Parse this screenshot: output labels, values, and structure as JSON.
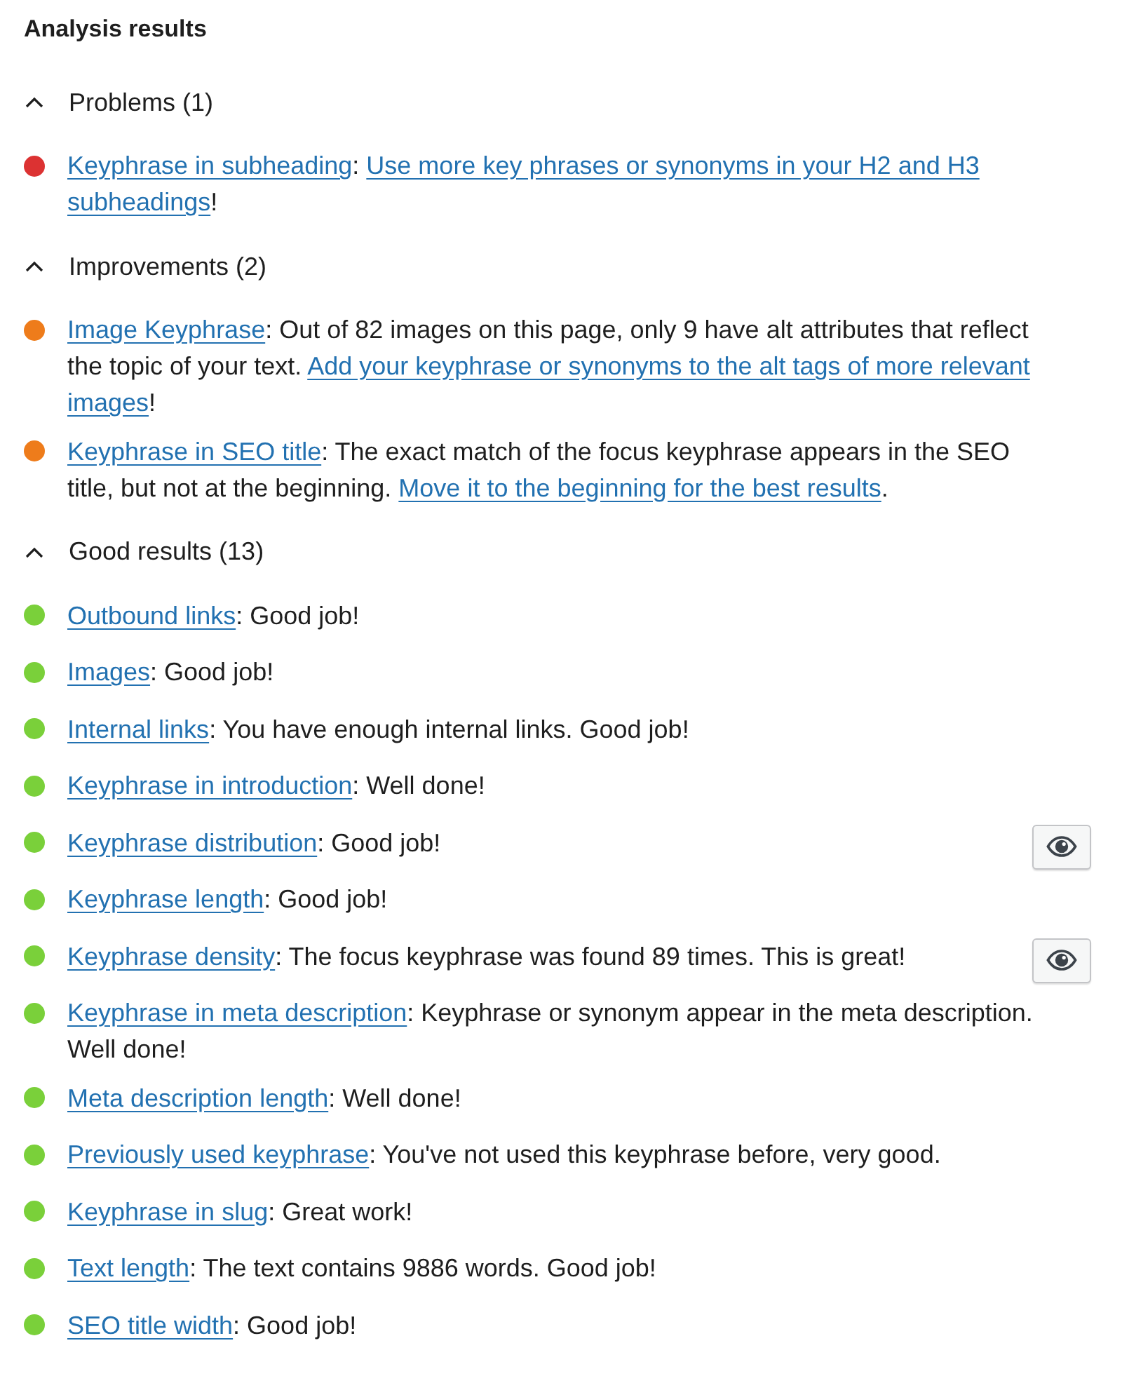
{
  "title": "Analysis results",
  "sections": [
    {
      "heading": "Problems (1)",
      "expanded": true,
      "results": [
        {
          "color": "#dc3232",
          "highlight_button": false,
          "segments": [
            {
              "text": "Keyphrase in subheading",
              "kind": "link"
            },
            {
              "text": ": ",
              "kind": "plain"
            },
            {
              "text": "Use more key phrases or synonyms in your H2 and H3",
              "kind": "link"
            },
            {
              "text": "subheadings",
              "kind": "link"
            },
            {
              "text": "!",
              "kind": "plain"
            }
          ]
        }
      ]
    },
    {
      "heading": "Improvements (2)",
      "expanded": true,
      "results": [
        {
          "color": "#ee7c1b",
          "highlight_button": false,
          "segments": [
            {
              "text": "Image Keyphrase",
              "kind": "link"
            },
            {
              "text": ": Out of 82 images on this page, only 9 have alt attributes that reflect the topic of your text. ",
              "kind": "plain"
            },
            {
              "text": "Add your keyphrase or synonyms to the alt tags of more relevant",
              "kind": "link"
            },
            {
              "text": "images",
              "kind": "link"
            },
            {
              "text": "!",
              "kind": "plain"
            }
          ]
        },
        {
          "color": "#ee7c1b",
          "highlight_button": false,
          "segments": [
            {
              "text": "Keyphrase in SEO title",
              "kind": "link"
            },
            {
              "text": ": The exact match of the focus keyphrase appears in the SEO title, but not at the beginning. ",
              "kind": "plain"
            },
            {
              "text": "Move it to the beginning for the best results",
              "kind": "link"
            },
            {
              "text": ".",
              "kind": "plain"
            }
          ]
        }
      ]
    },
    {
      "heading": "Good results (13)",
      "expanded": true,
      "results": [
        {
          "color": "#7ad03a",
          "highlight_button": false,
          "segments": [
            {
              "text": "Outbound links",
              "kind": "link"
            },
            {
              "text": ": Good job!",
              "kind": "plain"
            }
          ]
        },
        {
          "color": "#7ad03a",
          "highlight_button": false,
          "segments": [
            {
              "text": "Images",
              "kind": "link"
            },
            {
              "text": ": Good job!",
              "kind": "plain"
            }
          ]
        },
        {
          "color": "#7ad03a",
          "highlight_button": false,
          "segments": [
            {
              "text": "Internal links",
              "kind": "link"
            },
            {
              "text": ": You have enough internal links. Good job!",
              "kind": "plain"
            }
          ]
        },
        {
          "color": "#7ad03a",
          "highlight_button": false,
          "segments": [
            {
              "text": "Keyphrase in introduction",
              "kind": "link"
            },
            {
              "text": ": Well done!",
              "kind": "plain"
            }
          ]
        },
        {
          "color": "#7ad03a",
          "highlight_button": true,
          "segments": [
            {
              "text": "Keyphrase distribution",
              "kind": "link"
            },
            {
              "text": ": Good job!",
              "kind": "plain"
            }
          ]
        },
        {
          "color": "#7ad03a",
          "highlight_button": false,
          "segments": [
            {
              "text": "Keyphrase length",
              "kind": "link"
            },
            {
              "text": ": Good job!",
              "kind": "plain"
            }
          ]
        },
        {
          "color": "#7ad03a",
          "highlight_button": true,
          "segments": [
            {
              "text": "Keyphrase density",
              "kind": "link"
            },
            {
              "text": ": The focus keyphrase was found 89 times. This is great!",
              "kind": "plain"
            }
          ]
        },
        {
          "color": "#7ad03a",
          "highlight_button": false,
          "segments": [
            {
              "text": "Keyphrase in meta description",
              "kind": "link"
            },
            {
              "text": ": Keyphrase or synonym appear in the meta description. Well done!",
              "kind": "plain"
            }
          ]
        },
        {
          "color": "#7ad03a",
          "highlight_button": false,
          "segments": [
            {
              "text": "Meta description length",
              "kind": "link"
            },
            {
              "text": ": Well done!",
              "kind": "plain"
            }
          ]
        },
        {
          "color": "#7ad03a",
          "highlight_button": false,
          "segments": [
            {
              "text": "Previously used keyphrase",
              "kind": "link"
            },
            {
              "text": ": You've not used this keyphrase before, very good.",
              "kind": "plain"
            }
          ]
        },
        {
          "color": "#7ad03a",
          "highlight_button": false,
          "segments": [
            {
              "text": "Keyphrase in slug",
              "kind": "link"
            },
            {
              "text": ": Great work!",
              "kind": "plain"
            }
          ]
        },
        {
          "color": "#7ad03a",
          "highlight_button": false,
          "segments": [
            {
              "text": "Text length",
              "kind": "link"
            },
            {
              "text": ": The text contains 9886 words. Good job!",
              "kind": "plain"
            }
          ]
        },
        {
          "color": "#7ad03a",
          "highlight_button": false,
          "segments": [
            {
              "text": "SEO title width",
              "kind": "link"
            },
            {
              "text": ": Good job!",
              "kind": "plain"
            }
          ]
        }
      ]
    }
  ]
}
